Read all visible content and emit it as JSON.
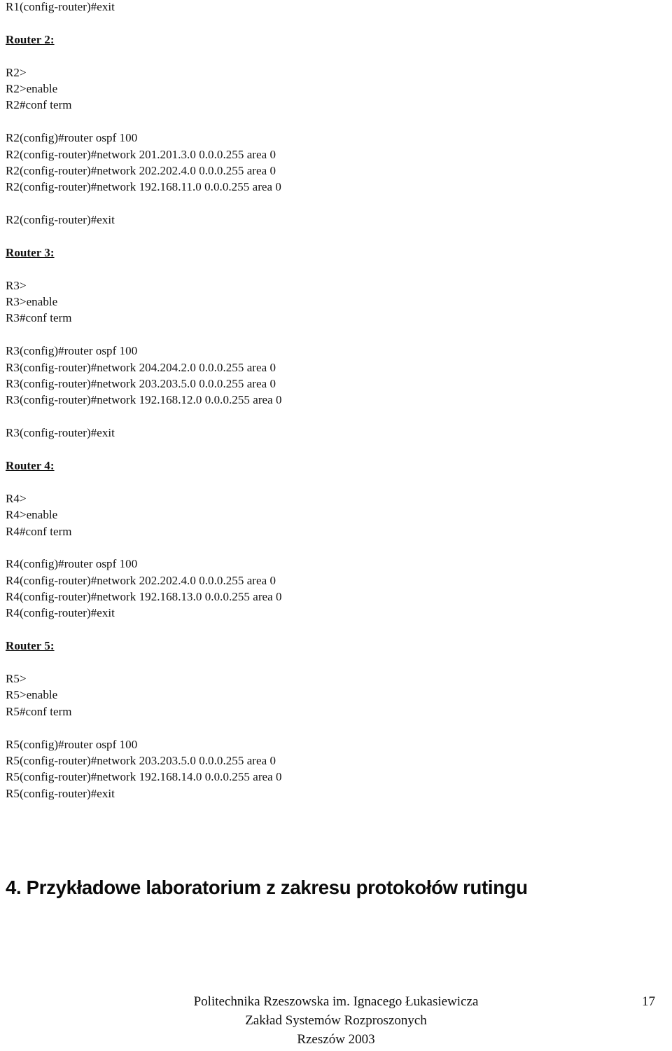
{
  "document": {
    "page_number": "17",
    "transcript_lines": [
      {
        "type": "text",
        "text": "R1(config-router)#exit"
      },
      {
        "type": "blank",
        "text": ""
      },
      {
        "type": "heading",
        "text": "Router 2:"
      },
      {
        "type": "blank",
        "text": ""
      },
      {
        "type": "text",
        "text": "R2>"
      },
      {
        "type": "text",
        "text": "R2>enable"
      },
      {
        "type": "text",
        "text": "R2#conf term"
      },
      {
        "type": "blank",
        "text": ""
      },
      {
        "type": "text",
        "text": "R2(config)#router ospf 100"
      },
      {
        "type": "text",
        "text": "R2(config-router)#network 201.201.3.0 0.0.0.255 area 0"
      },
      {
        "type": "text",
        "text": "R2(config-router)#network 202.202.4.0 0.0.0.255 area 0"
      },
      {
        "type": "text",
        "text": "R2(config-router)#network 192.168.11.0 0.0.0.255 area 0"
      },
      {
        "type": "blank",
        "text": ""
      },
      {
        "type": "text",
        "text": "R2(config-router)#exit"
      },
      {
        "type": "blank",
        "text": ""
      },
      {
        "type": "heading",
        "text": "Router 3:"
      },
      {
        "type": "blank",
        "text": ""
      },
      {
        "type": "text",
        "text": "R3>"
      },
      {
        "type": "text",
        "text": "R3>enable"
      },
      {
        "type": "text",
        "text": "R3#conf term"
      },
      {
        "type": "blank",
        "text": ""
      },
      {
        "type": "text",
        "text": "R3(config)#router ospf 100"
      },
      {
        "type": "text",
        "text": "R3(config-router)#network 204.204.2.0 0.0.0.255 area 0"
      },
      {
        "type": "text",
        "text": "R3(config-router)#network 203.203.5.0 0.0.0.255 area 0"
      },
      {
        "type": "text",
        "text": "R3(config-router)#network 192.168.12.0 0.0.0.255 area 0"
      },
      {
        "type": "blank",
        "text": ""
      },
      {
        "type": "text",
        "text": "R3(config-router)#exit"
      },
      {
        "type": "blank",
        "text": ""
      },
      {
        "type": "heading",
        "text": "Router 4:"
      },
      {
        "type": "blank",
        "text": ""
      },
      {
        "type": "text",
        "text": "R4>"
      },
      {
        "type": "text",
        "text": "R4>enable"
      },
      {
        "type": "text",
        "text": "R4#conf term"
      },
      {
        "type": "blank",
        "text": ""
      },
      {
        "type": "text",
        "text": "R4(config)#router ospf 100"
      },
      {
        "type": "text",
        "text": "R4(config-router)#network 202.202.4.0 0.0.0.255 area 0"
      },
      {
        "type": "text",
        "text": "R4(config-router)#network 192.168.13.0 0.0.0.255 area 0"
      },
      {
        "type": "text",
        "text": "R4(config-router)#exit"
      },
      {
        "type": "blank",
        "text": ""
      },
      {
        "type": "heading",
        "text": "Router 5:"
      },
      {
        "type": "blank",
        "text": ""
      },
      {
        "type": "text",
        "text": "R5>"
      },
      {
        "type": "text",
        "text": "R5>enable"
      },
      {
        "type": "text",
        "text": "R5#conf term"
      },
      {
        "type": "blank",
        "text": ""
      },
      {
        "type": "text",
        "text": "R5(config)#router ospf 100"
      },
      {
        "type": "text",
        "text": "R5(config-router)#network 203.203.5.0 0.0.0.255 area 0"
      },
      {
        "type": "text",
        "text": "R5(config-router)#network 192.168.14.0 0.0.0.255 area 0"
      },
      {
        "type": "text",
        "text": "R5(config-router)#exit"
      }
    ],
    "section_title": "4. Przykładowe laboratorium z zakresu protokołów rutingu",
    "footer": {
      "line1": "Politechnika Rzeszowska im. Ignacego Łukasiewicza",
      "line2": "Zakład Systemów Rozproszonych",
      "line3": "Rzeszów 2003"
    }
  }
}
